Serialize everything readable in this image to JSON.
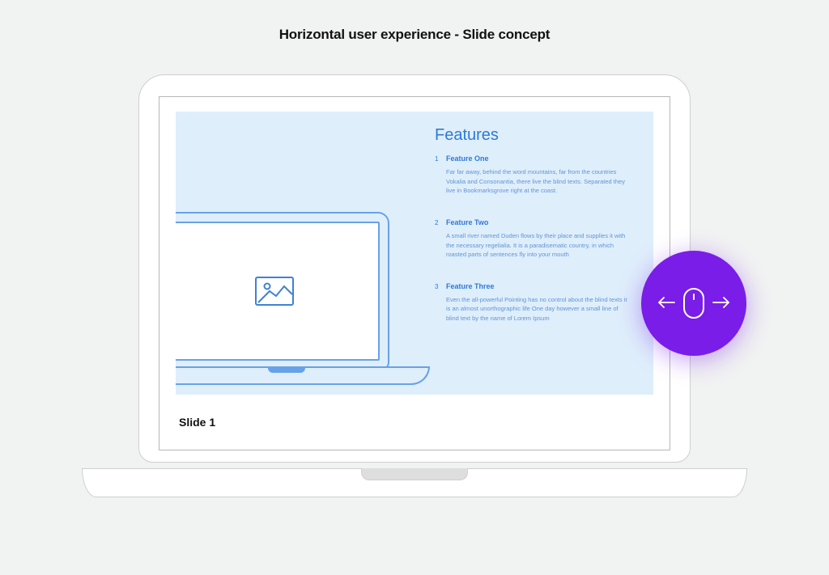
{
  "heading": "Horizontal user experience -  Slide concept",
  "slide_label": "Slide 1",
  "features": {
    "title": "Features",
    "items": [
      {
        "num": "1",
        "title": "Feature One",
        "body": "Far far away, behind the word mountains, far from the countries Vokalia and Consonantia, there live the blind texts. Separated they live in Bookmarksgrove right at the coast."
      },
      {
        "num": "2",
        "title": "Feature Two",
        "body": "A small river named Duden flows by their place and supplies it with the necessary regelialia. It is a paradisematic country, in which roasted parts of sentences fly into your mouth"
      },
      {
        "num": "3",
        "title": "Feature Three",
        "body": "Even the all-powerful Pointing has no control about the blind texts it is an almost unorthographic life One day however a small line of blind text by the name of Lorem Ipsum"
      }
    ]
  }
}
